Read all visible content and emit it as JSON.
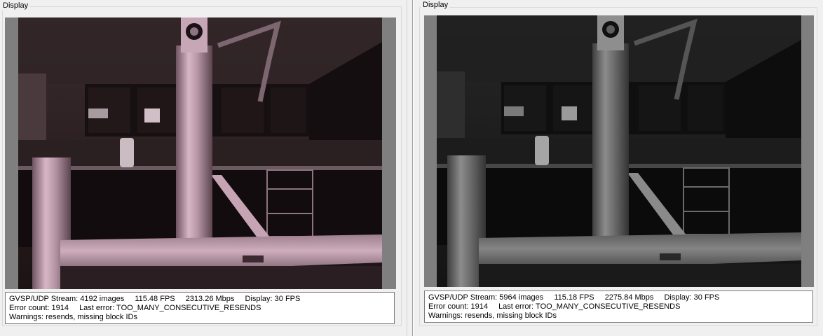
{
  "left": {
    "group_title": "Display",
    "stream": {
      "label": "GVSP/UDP Stream:",
      "images": "4192 images",
      "fps": "115.48 FPS",
      "bandwidth": "2313.26 Mbps",
      "display": "Display: 30 FPS"
    },
    "errors": {
      "count": "Error count: 1914",
      "last": "Last error: TOO_MANY_CONSECUTIVE_RESENDS"
    },
    "warnings": "Warnings: resends, missing block IDs",
    "tint": "#b896a4"
  },
  "right": {
    "group_title": "Display",
    "stream": {
      "label": "GVSP/UDP Stream:",
      "images": "5964 images",
      "fps": "115.18 FPS",
      "bandwidth": "2275.84 Mbps",
      "display": "Display: 30 FPS"
    },
    "errors": {
      "count": "Error count: 1914",
      "last": "Last error: TOO_MANY_CONSECUTIVE_RESENDS"
    },
    "warnings": "Warnings: resends, missing block IDs",
    "tint": "#8c8c8c"
  },
  "colors": {
    "background": "#f0f0f0",
    "viewport_letterbox": "#7f7f7f",
    "status_border": "#7a7a7a"
  }
}
